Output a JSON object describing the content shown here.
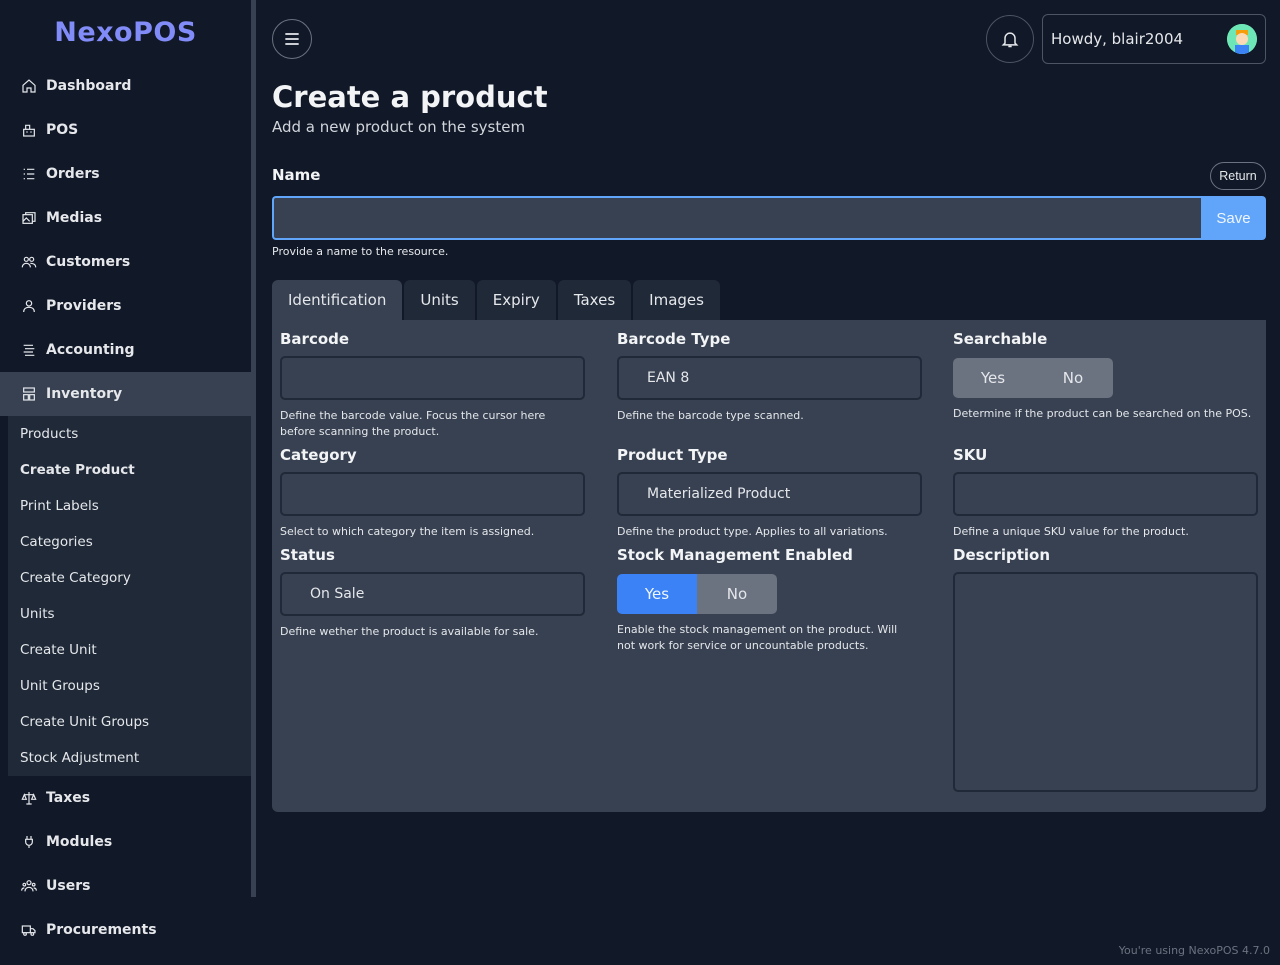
{
  "app": {
    "logo": "NexoPOS",
    "footer": "You're using NexoPOS 4.7.0"
  },
  "sidebar": {
    "items": [
      {
        "label": "Dashboard",
        "icon": "home-icon"
      },
      {
        "label": "POS",
        "icon": "cash-register-icon"
      },
      {
        "label": "Orders",
        "icon": "list-icon"
      },
      {
        "label": "Medias",
        "icon": "images-icon"
      },
      {
        "label": "Customers",
        "icon": "users-icon"
      },
      {
        "label": "Providers",
        "icon": "user-icon"
      },
      {
        "label": "Accounting",
        "icon": "accounting-icon"
      },
      {
        "label": "Inventory",
        "icon": "inventory-icon"
      },
      {
        "label": "Taxes",
        "icon": "balance-scale-icon"
      },
      {
        "label": "Modules",
        "icon": "plug-icon"
      },
      {
        "label": "Users",
        "icon": "user-group-icon"
      },
      {
        "label": "Procurements",
        "icon": "truck-icon"
      }
    ],
    "inventory_sub": [
      "Products",
      "Create Product",
      "Print Labels",
      "Categories",
      "Create Category",
      "Units",
      "Create Unit",
      "Unit Groups",
      "Create Unit Groups",
      "Stock Adjustment"
    ]
  },
  "header": {
    "greeting": "Howdy, blair2004"
  },
  "page": {
    "title": "Create a product",
    "subtitle": "Add a new product on the system",
    "name_label": "Name",
    "return_label": "Return",
    "save_label": "Save",
    "name_value": "",
    "name_help": "Provide a name to the resource."
  },
  "tabs": [
    "Identification",
    "Units",
    "Expiry",
    "Taxes",
    "Images"
  ],
  "form": {
    "barcode": {
      "label": "Barcode",
      "value": "",
      "help": "Define the barcode value. Focus the cursor here before scanning the product."
    },
    "barcode_type": {
      "label": "Barcode Type",
      "value": "EAN 8",
      "help": "Define the barcode type scanned."
    },
    "searchable": {
      "label": "Searchable",
      "yes": "Yes",
      "no": "No",
      "help": "Determine if the product can be searched on the POS."
    },
    "category": {
      "label": "Category",
      "value": "",
      "help": "Select to which category the item is assigned."
    },
    "product_type": {
      "label": "Product Type",
      "value": "Materialized Product",
      "help": "Define the product type. Applies to all variations."
    },
    "sku": {
      "label": "SKU",
      "value": "",
      "help": "Define a unique SKU value for the product."
    },
    "status": {
      "label": "Status",
      "value": "On Sale",
      "help": "Define wether the product is available for sale."
    },
    "stock": {
      "label": "Stock Management Enabled",
      "yes": "Yes",
      "no": "No",
      "help": "Enable the stock management on the product. Will not work for service or uncountable products."
    },
    "description": {
      "label": "Description",
      "value": ""
    }
  },
  "colors": {
    "accent": "#60a5fa",
    "logo": "#818cf8",
    "toggle_on": "#3b82f6"
  }
}
